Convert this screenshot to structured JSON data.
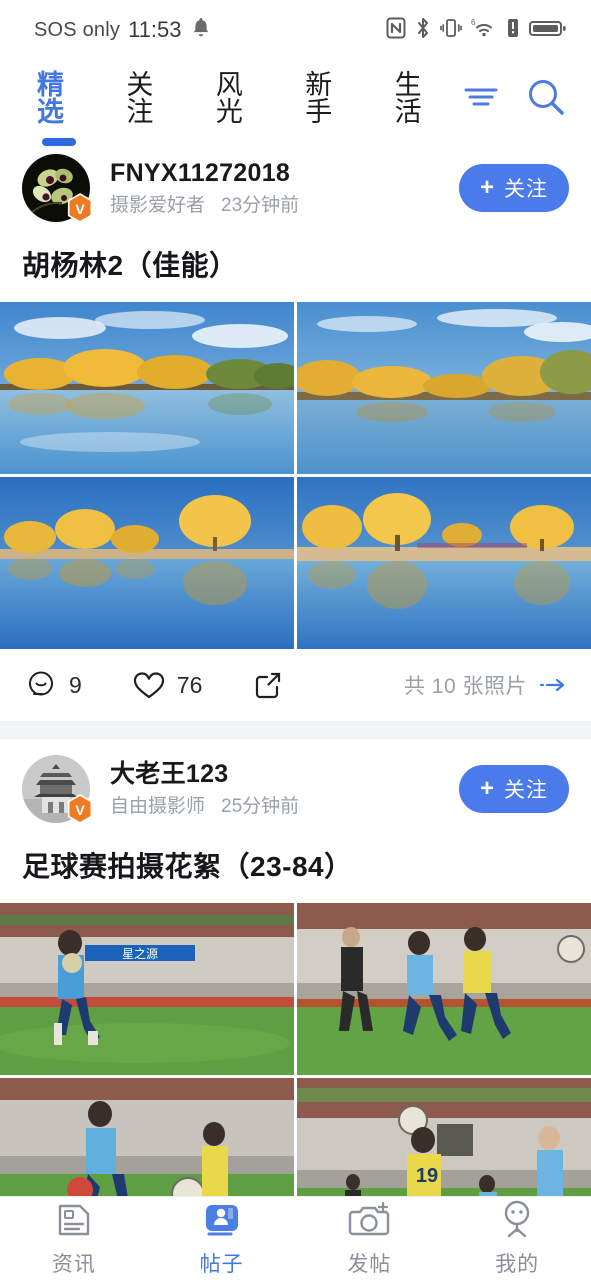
{
  "status_bar": {
    "carrier": "SOS only",
    "time": "11:53",
    "icons": [
      "bell-icon",
      "nfc-icon",
      "bluetooth-icon",
      "vibrate-icon",
      "wifi-6-icon",
      "alert-icon",
      "battery-icon"
    ]
  },
  "tabs": {
    "items": [
      {
        "label": "精选",
        "active": true
      },
      {
        "label": "关注",
        "active": false
      },
      {
        "label": "风光",
        "active": false
      },
      {
        "label": "新手",
        "active": false
      },
      {
        "label": "生活",
        "active": false
      }
    ],
    "actions": [
      "filter-icon",
      "search-icon"
    ],
    "active_color": "#4477e0",
    "underline_color": "#2f6ae0"
  },
  "posts": [
    {
      "user": {
        "name": "FNYX11272018",
        "role": "摄影爱好者",
        "time": "23分钟前",
        "verified_badge": "V",
        "avatar": "orchid-photo"
      },
      "follow_label": "关注",
      "follow_plus": "+",
      "title": "胡杨林2（佳能）",
      "images": [
        "autumn-lake-1",
        "autumn-lake-2",
        "autumn-lake-3",
        "autumn-lake-4"
      ],
      "actions": {
        "comment_count": "9",
        "like_count": "76",
        "share": "share-icon"
      },
      "photo_count_text": "共 10 张照片"
    },
    {
      "user": {
        "name": "大老王123",
        "role": "自由摄影师",
        "time": "25分钟前",
        "verified_badge": "V",
        "avatar": "pagoda-photo"
      },
      "follow_label": "关注",
      "follow_plus": "+",
      "title": "足球赛拍摄花絮（23-84）",
      "images": [
        "soccer-1",
        "soccer-2",
        "soccer-3",
        "soccer-4"
      ]
    }
  ],
  "bottom_nav": {
    "items": [
      {
        "label": "资讯",
        "icon": "news-icon",
        "active": false
      },
      {
        "label": "帖子",
        "icon": "posts-icon",
        "active": true
      },
      {
        "label": "发帖",
        "icon": "camera-add-icon",
        "active": false
      },
      {
        "label": "我的",
        "icon": "profile-icon",
        "active": false
      }
    ],
    "active_color": "#4477e0"
  },
  "theme": {
    "accent": "#4b7aea",
    "badge_orange": "#ef7a22",
    "divider": "#f1f3f5",
    "muted_text": "#9aa0a8"
  }
}
